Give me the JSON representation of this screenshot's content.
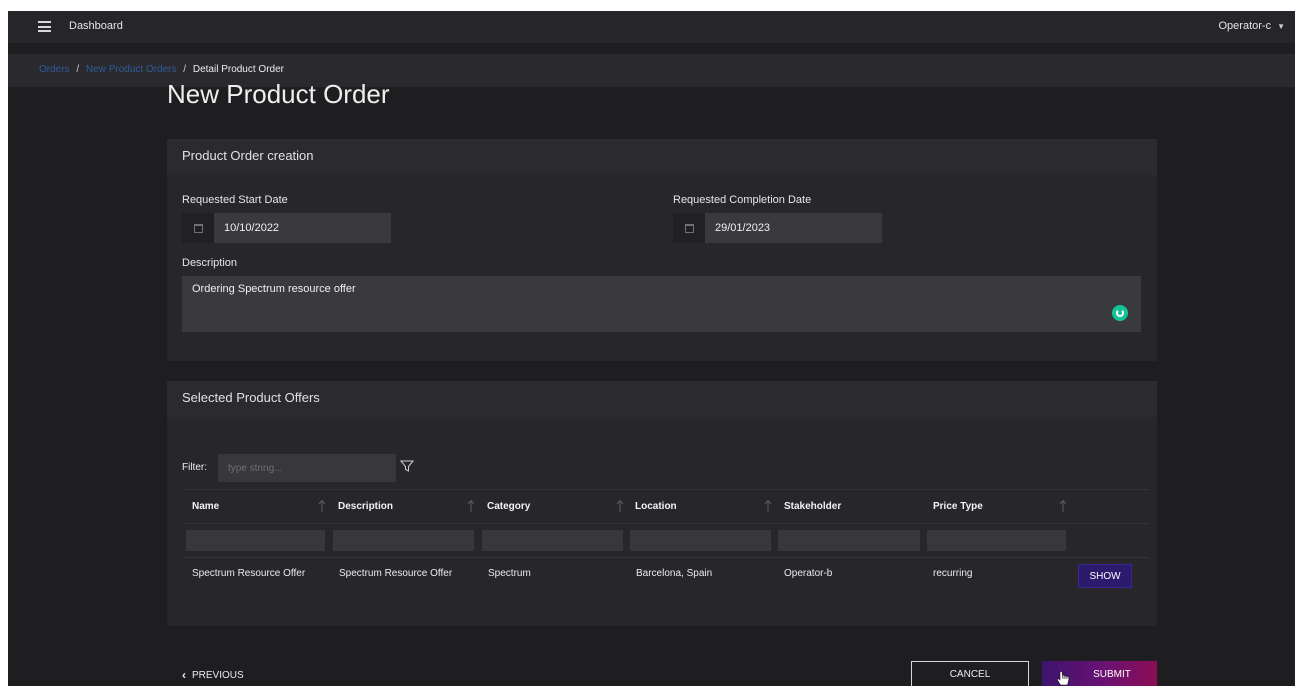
{
  "topbar": {
    "title": "Dashboard",
    "user": "Operator-c"
  },
  "breadcrumb": {
    "items": [
      "Orders",
      "New Product Orders"
    ],
    "current": "Detail Product Order"
  },
  "page_title": "New Product Order",
  "creation": {
    "title": "Product Order creation",
    "start_label": "Requested Start Date",
    "start_value": "10/10/2022",
    "completion_label": "Requested Completion Date",
    "completion_value": "29/01/2023",
    "description_label": "Description",
    "description_value": "Ordering Spectrum resource offer"
  },
  "offers": {
    "title": "Selected Product Offers",
    "filter_label": "Filter:",
    "filter_placeholder": "type string...",
    "columns": [
      "Name",
      "Description",
      "Category",
      "Location",
      "Stakeholder",
      "Price Type"
    ],
    "rows": [
      [
        "Spectrum Resource Offer",
        "Spectrum Resource Offer",
        "Spectrum",
        "Barcelona, Spain",
        "Operator-b",
        "recurring"
      ]
    ],
    "show_label": "SHOW"
  },
  "actions": {
    "previous": "PREVIOUS",
    "cancel": "CANCEL",
    "submit": "SUBMIT"
  },
  "colors": {
    "background": "#1e1e21",
    "panel": "#27272b",
    "accent": "#2c1a6c",
    "submit_gradient_end": "#8b0d55",
    "breadcrumb_link": "#2f5b9c"
  }
}
